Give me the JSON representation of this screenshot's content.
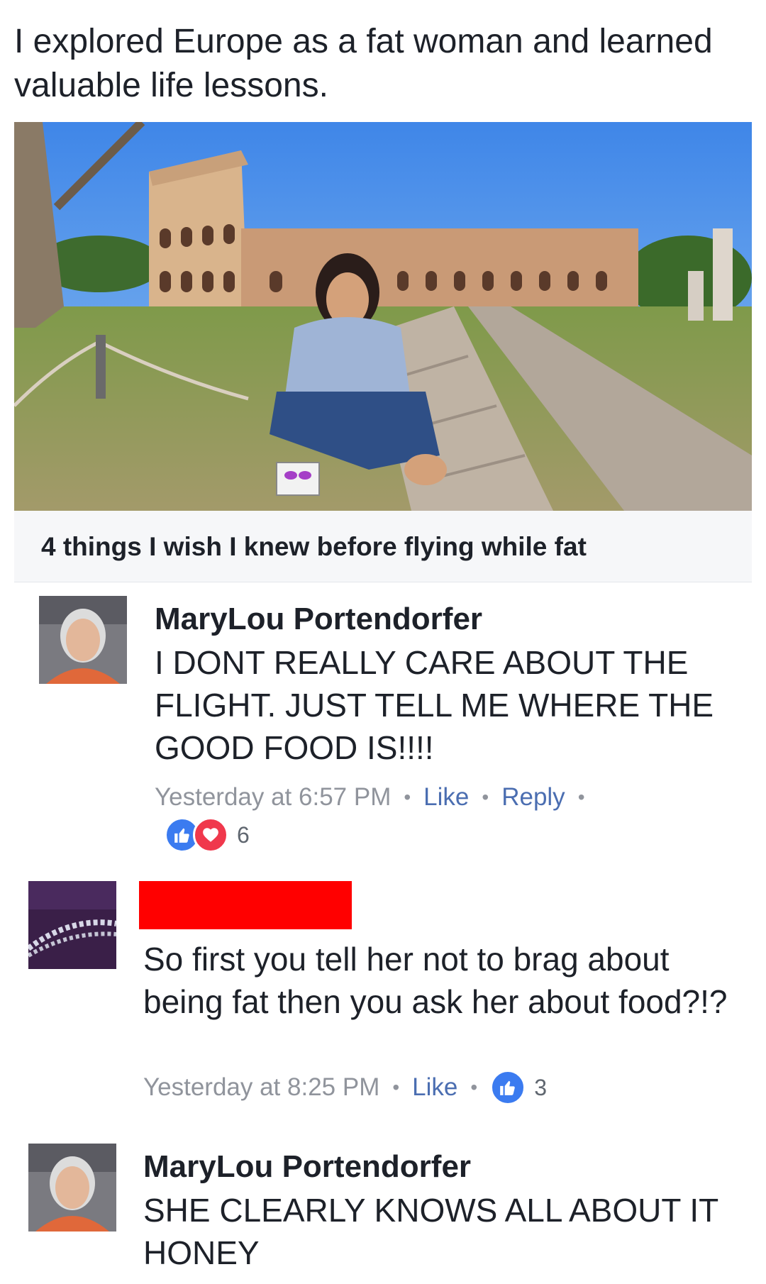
{
  "post": {
    "text": "I explored Europe as a fat woman and learned valuable life lessons.",
    "link_title": "4 things I wish I knew before flying while fat"
  },
  "comments": [
    {
      "author": "MaryLou Portendorfer",
      "text": "I DONT REALLY CARE ABOUT THE FLIGHT. JUST TELL ME WHERE THE GOOD FOOD IS!!!!",
      "time": "Yesterday at 6:57 PM",
      "like_label": "Like",
      "reply_label": "Reply",
      "reactions": [
        "like-icon",
        "love-icon"
      ],
      "reaction_count": "6"
    },
    {
      "author": "",
      "author_redacted": true,
      "text": "So first you tell her not to brag about being fat then you ask her about food?!?",
      "time": "Yesterday at 8:25 PM",
      "like_label": "Like",
      "reactions": [
        "like-icon"
      ],
      "reaction_count": "3"
    },
    {
      "author": "MaryLou Portendorfer",
      "text": "SHE CLEARLY KNOWS ALL ABOUT IT HONEY"
    }
  ],
  "colors": {
    "link_blue": "#4b6eb1",
    "meta_gray": "#90949c",
    "like_blue": "#3b7bf0",
    "love_red": "#f0384c",
    "redaction": "#ff0000"
  }
}
